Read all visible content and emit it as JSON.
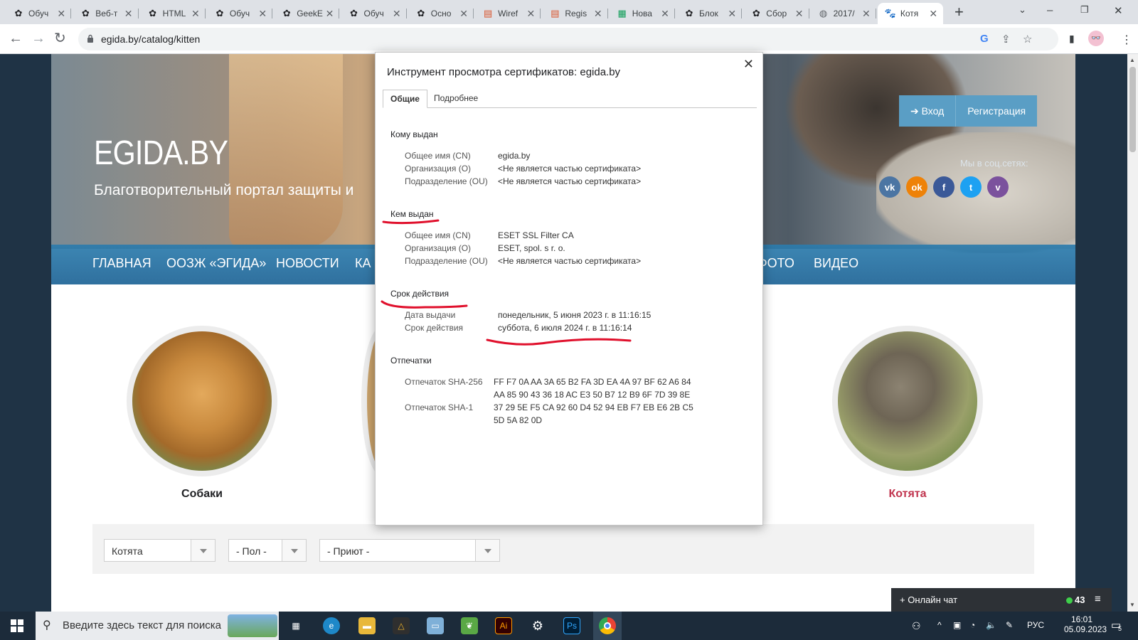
{
  "browser": {
    "tabs": [
      {
        "title": "Обуч",
        "icon": "openai-icon"
      },
      {
        "title": "Веб-т",
        "icon": "openai-icon"
      },
      {
        "title": "HTML",
        "icon": "openai-icon"
      },
      {
        "title": "Обуч",
        "icon": "openai-icon"
      },
      {
        "title": "GeekE",
        "icon": "openai-icon"
      },
      {
        "title": "Обуч",
        "icon": "openai-icon"
      },
      {
        "title": "Осно",
        "icon": "openai-icon"
      },
      {
        "title": "Wiref",
        "icon": "wireframe-icon"
      },
      {
        "title": "Regis",
        "icon": "wireframe-icon"
      },
      {
        "title": "Нова",
        "icon": "sheets-icon"
      },
      {
        "title": "Блок",
        "icon": "openai-icon"
      },
      {
        "title": "Сбор",
        "icon": "openai-icon"
      },
      {
        "title": "2017/",
        "icon": "globe-icon"
      },
      {
        "title": "Котя",
        "icon": "paw-icon",
        "active": true
      }
    ],
    "url": "egida.by/catalog/kitten"
  },
  "site": {
    "logo": "EGIDA.BY",
    "tagline": "Благотворительный портал защиты и",
    "auth": {
      "login": "Вход",
      "register": "Регистрация"
    },
    "social_title": "Мы в соц.сетях:",
    "social": [
      {
        "name": "vk",
        "glyph": "vk",
        "color": "#4c75a3"
      },
      {
        "name": "odnoklassniki",
        "glyph": "ok",
        "color": "#ee8208"
      },
      {
        "name": "facebook",
        "glyph": "f",
        "color": "#3b5998"
      },
      {
        "name": "twitter",
        "glyph": "t",
        "color": "#1da1f2"
      },
      {
        "name": "viber",
        "glyph": "v",
        "color": "#7b519d"
      }
    ],
    "menu": [
      "ГЛАВНАЯ",
      "ООЗЖ «ЭГИДА»",
      "НОВОСТИ",
      "КА",
      "ФОТО",
      "ВИДЕО"
    ],
    "categories": [
      {
        "label": "Собаки",
        "color": "#333333"
      },
      {
        "label": "Котята",
        "color": "#c0334d"
      }
    ],
    "filters": {
      "type": "Котята",
      "sex": "- Пол -",
      "shelter": "- Приют -"
    },
    "chat": {
      "label": "+ Онлайн чат",
      "count": "43"
    }
  },
  "dialog": {
    "title": "Инструмент просмотра сертификатов: egida.by",
    "tabs": [
      "Общие",
      "Подробнее"
    ],
    "issued_to": {
      "heading": "Кому выдан",
      "rows": [
        {
          "label": "Общее имя (CN)",
          "value": "egida.by"
        },
        {
          "label": "Организация (O)",
          "value": "<Не является частью сертификата>"
        },
        {
          "label": "Подразделение (OU)",
          "value": "<Не является частью сертификата>"
        }
      ]
    },
    "issued_by": {
      "heading": "Кем выдан",
      "rows": [
        {
          "label": "Общее имя (CN)",
          "value": "ESET SSL Filter CA"
        },
        {
          "label": "Организация (O)",
          "value": "ESET, spol. s r. o."
        },
        {
          "label": "Подразделение (OU)",
          "value": "<Не является частью сертификата>"
        }
      ]
    },
    "validity": {
      "heading": "Срок действия",
      "rows": [
        {
          "label": "Дата выдачи",
          "value": "понедельник, 5 июня 2023 г. в 11:16:15"
        },
        {
          "label": "Срок действия",
          "value": "суббота, 6 июля 2024 г. в 11:16:14"
        }
      ]
    },
    "fingerprints": {
      "heading": "Отпечатки",
      "rows": [
        {
          "label": "Отпечаток SHA-256",
          "line1": "FF F7 0A AA 3A 65 B2 FA 3D EA 4A 97 BF 62 A6 84",
          "line2": "AA 85 90 43 36 18 AC E3 50 B7 12 B9 6F 7D 39 8E"
        },
        {
          "label": "Отпечаток SHA-1",
          "line1": "37 29 5E F5 CA 92 60 D4 52 94 EB F7 EB E6 2B C5",
          "line2": "5D 5A 82 0D"
        }
      ]
    }
  },
  "taskbar": {
    "search_placeholder": "Введите здесь текст для поиска",
    "language": "РУС",
    "time": "16:01",
    "date": "05.09.2023",
    "notifications": "5"
  }
}
